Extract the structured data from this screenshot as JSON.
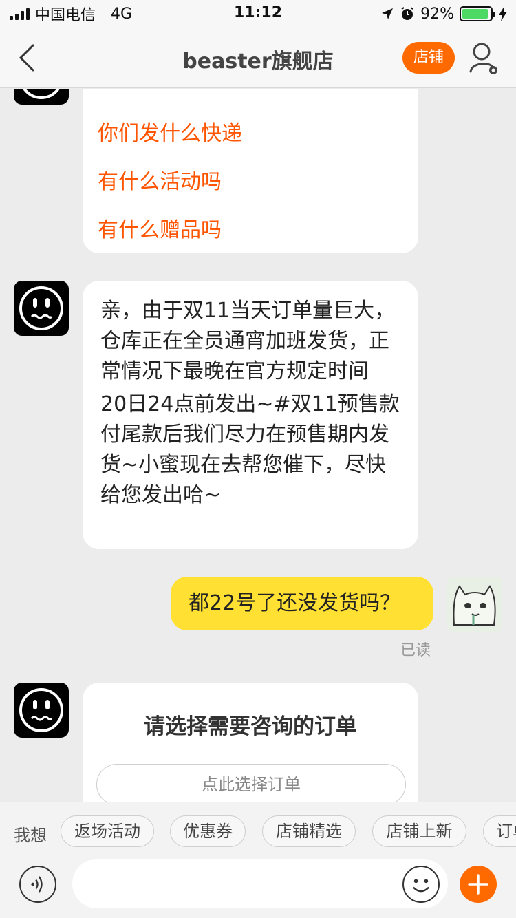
{
  "status_bar": {
    "carrier": "中国电信",
    "network": "4G",
    "time": "11:12",
    "battery": "92%",
    "battery_level": 0.92
  },
  "nav": {
    "title": "beaster旗舰店",
    "shop_button": "店铺",
    "icons": [
      "chevron-left-icon",
      "user-settings-icon"
    ]
  },
  "chat": {
    "faq_links": [
      "你们发什么快递",
      "有什么活动吗",
      "有什么赠品吗"
    ],
    "shop_reply": {
      "line1": "亲，由于双11当天订单量巨大，仓库正在全员通宵加班发货，正常情况下最晚在官方规定时间",
      "line2": "20日24点前发出~#双11预售款付尾款后我们尽力在预售期内发货~小蜜现在去帮您催下，尽快给您发出哈~"
    },
    "user_message": "都22号了还没发货吗？",
    "read_status": "已读",
    "order_card": {
      "title": "请选择需要咨询的订单",
      "button": "点此选择订单"
    }
  },
  "quick_replies": {
    "label": "我想",
    "chips": [
      "返场活动",
      "优惠券",
      "店铺精选",
      "店铺上新",
      "订单"
    ]
  },
  "input": {
    "placeholder": "",
    "icons": [
      "voice-icon",
      "emoji-icon",
      "plus-icon"
    ]
  },
  "colors": {
    "accent": "#ff6a00",
    "faq_text": "#ff5500",
    "user_bubble": "#ffe033",
    "battery": "#4cd964"
  }
}
